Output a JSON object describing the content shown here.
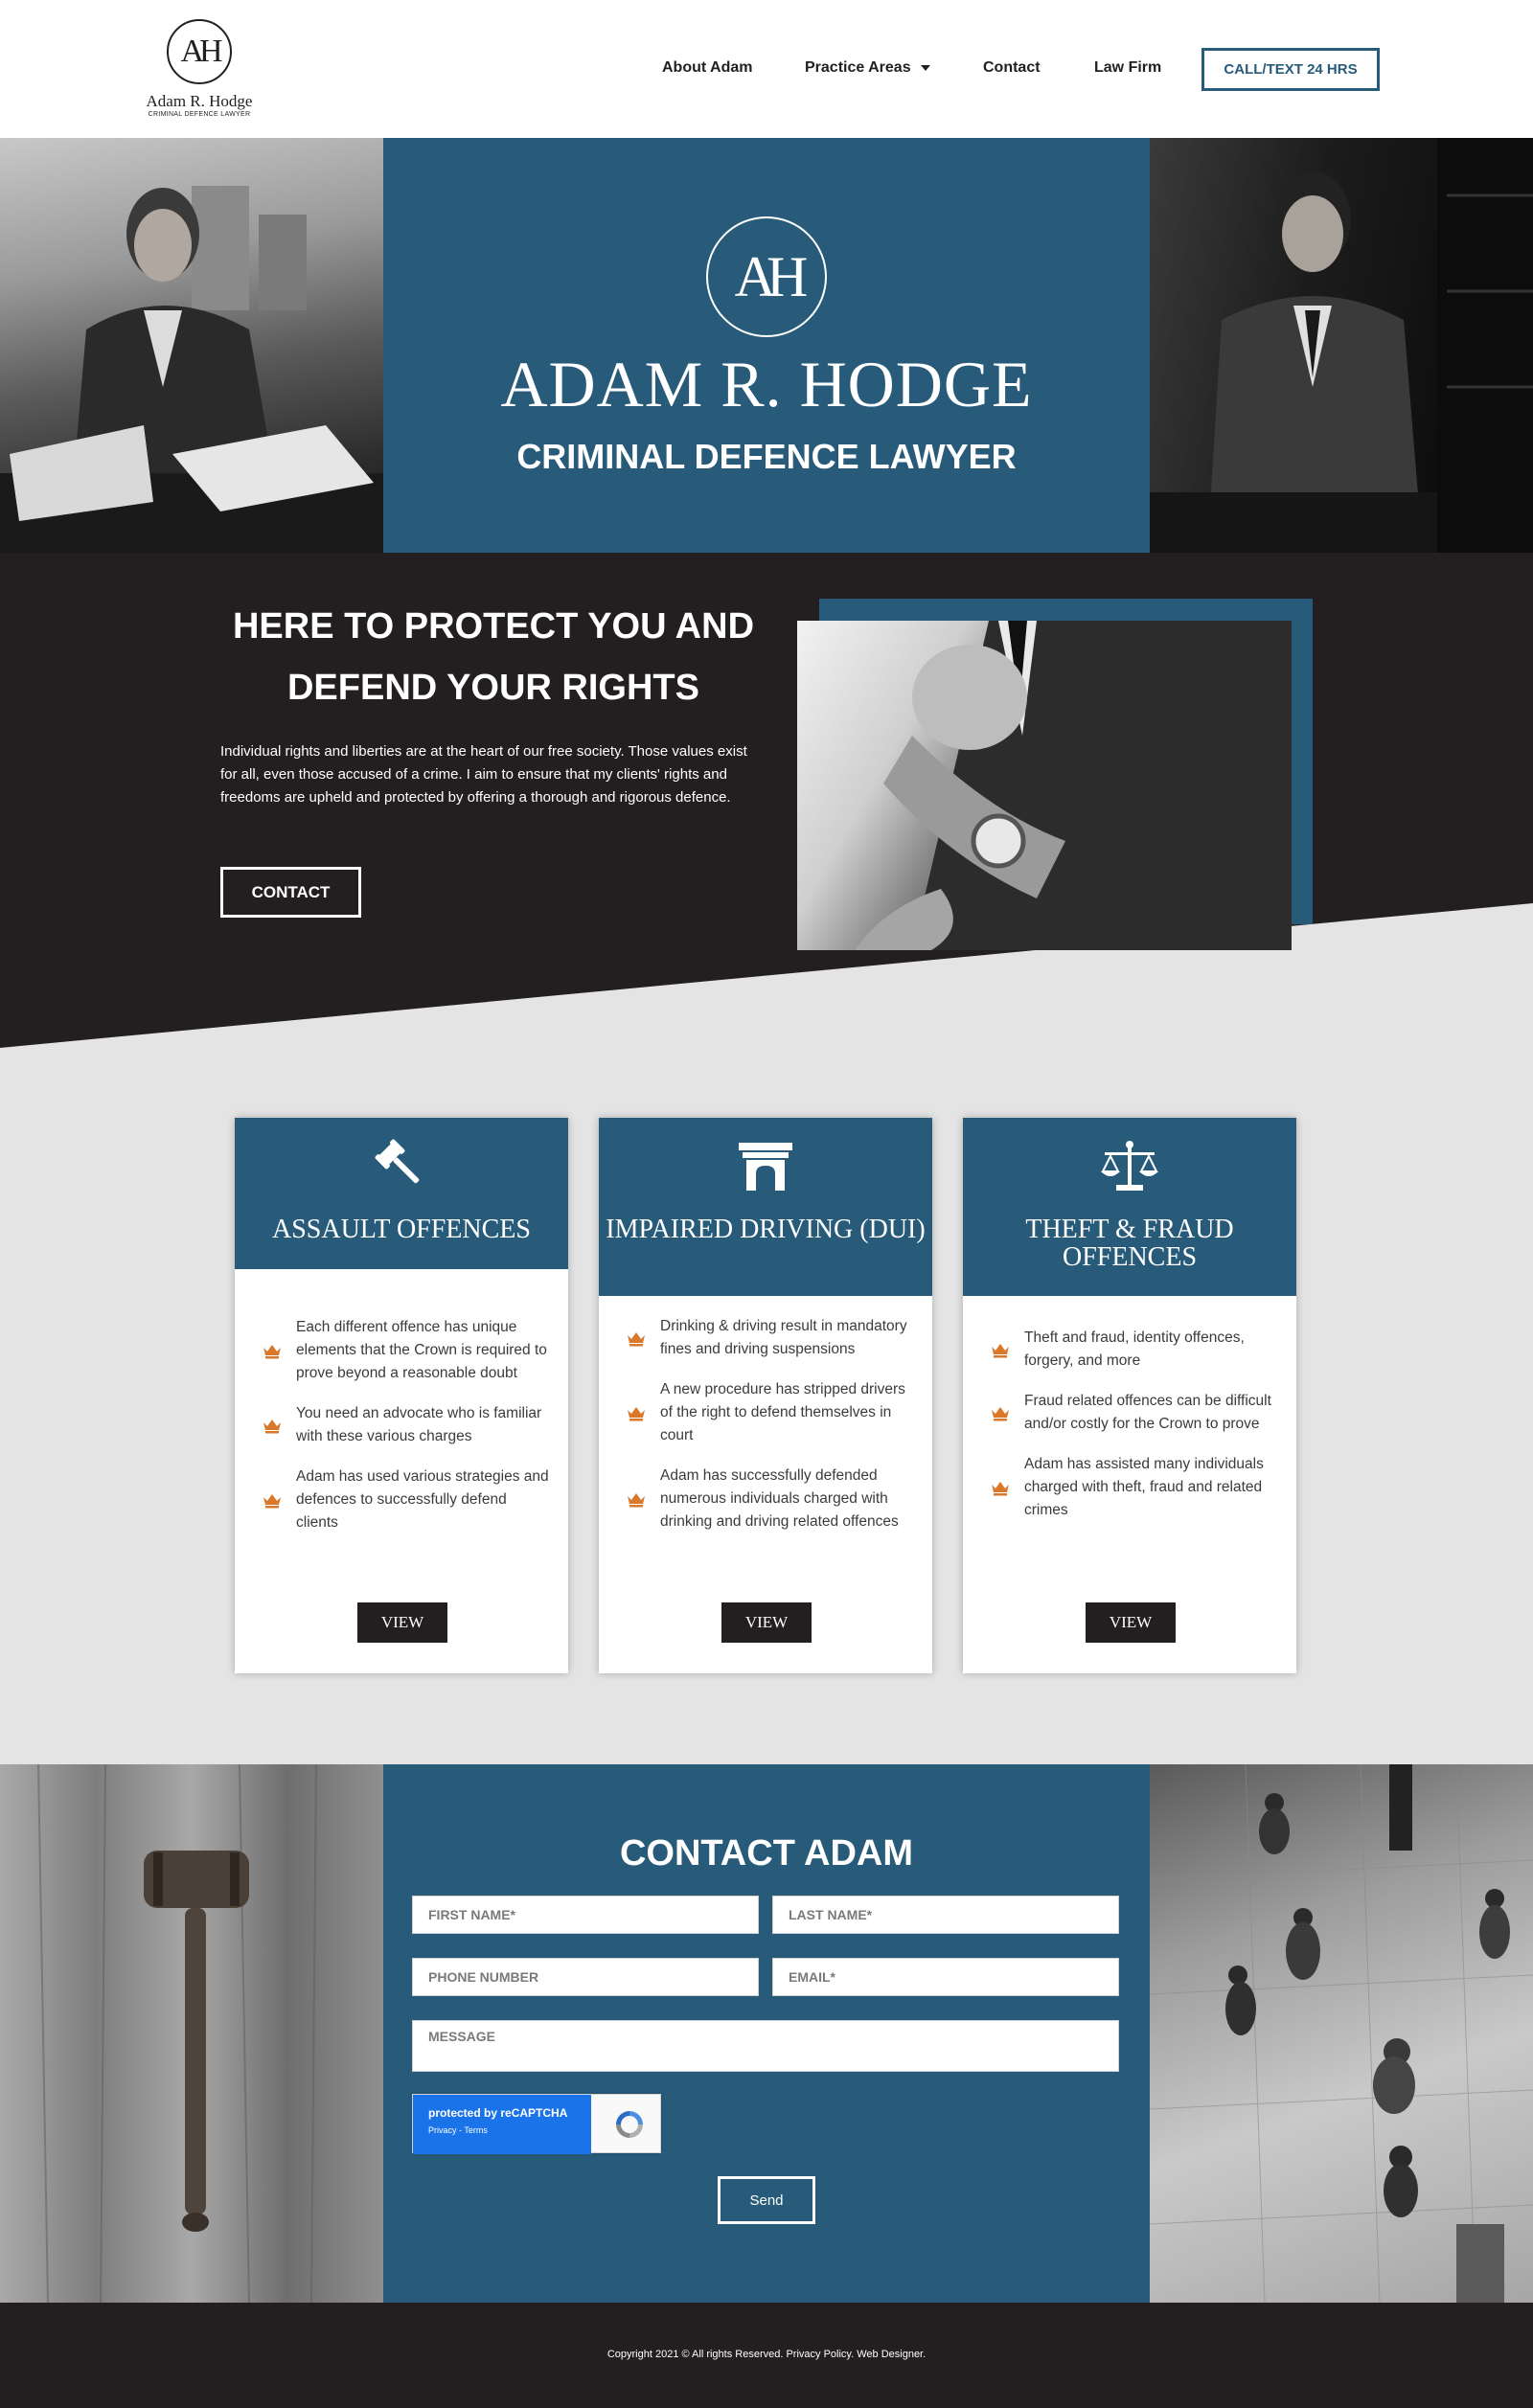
{
  "header": {
    "logo_monogram": "AH",
    "logo_name": "Adam R. Hodge",
    "logo_tagline": "CRIMINAL DEFENCE LAWYER",
    "nav": [
      {
        "label": "About Adam"
      },
      {
        "label": "Practice Areas"
      },
      {
        "label": "Contact"
      },
      {
        "label": "Law Firm"
      }
    ],
    "cta_label": "CALL/TEXT 24 HRS"
  },
  "hero": {
    "monogram": "AH",
    "name": "ADAM R. HODGE",
    "subtitle": "CRIMINAL DEFENCE LAWYER"
  },
  "protect": {
    "title_line1": "HERE TO PROTECT YOU AND",
    "title_line2": "DEFEND YOUR RIGHTS",
    "body": "Individual rights and liberties are at the heart of our free society. Those values exist for all, even those accused of a crime. I aim to ensure that my clients' rights and freedoms are upheld and protected by offering a thorough and rigorous defence.",
    "button_label": "CONTACT"
  },
  "services": [
    {
      "icon": "gavel-icon",
      "title": "ASSAULT OFFENCES",
      "items": [
        "Each different offence has unique elements that the Crown is required to prove beyond a reasonable doubt",
        "You need an advocate who is familiar with these various charges",
        "Adam has used various strategies and defences to successfully defend clients"
      ],
      "button_label": "VIEW"
    },
    {
      "icon": "courthouse-icon",
      "title": "IMPAIRED DRIVING (DUI)",
      "items": [
        "Drinking & driving result in mandatory fines and driving suspensions",
        "A new procedure has stripped drivers of the right to defend themselves in court",
        "Adam has successfully defended numerous individuals charged with drinking and driving related offences"
      ],
      "button_label": "VIEW"
    },
    {
      "icon": "scales-icon",
      "title": "THEFT & FRAUD OFFENCES",
      "items": [
        "Theft and fraud, identity offences, forgery, and more",
        "Fraud related offences can be difficult and/or costly for the Crown to prove",
        "Adam has assisted many individuals charged with theft, fraud and related crimes"
      ],
      "button_label": "VIEW"
    }
  ],
  "contact": {
    "title": "CONTACT ADAM",
    "fields": {
      "first_name": "FIRST NAME*",
      "last_name": "LAST NAME*",
      "phone": "PHONE NUMBER",
      "email": "EMAIL*",
      "message": "MESSAGE"
    },
    "recaptcha_line1": "protected by reCAPTCHA",
    "recaptcha_line2": "Privacy - Terms",
    "send_label": "Send"
  },
  "footer": {
    "copyright": "Copyright 2021 © All rights Reserved. Privacy Policy. Web Designer."
  },
  "colors": {
    "brand_blue": "#285b7a",
    "dark": "#231f20",
    "accent_orange": "#d9772b",
    "light_gray": "#e4e4e4"
  }
}
